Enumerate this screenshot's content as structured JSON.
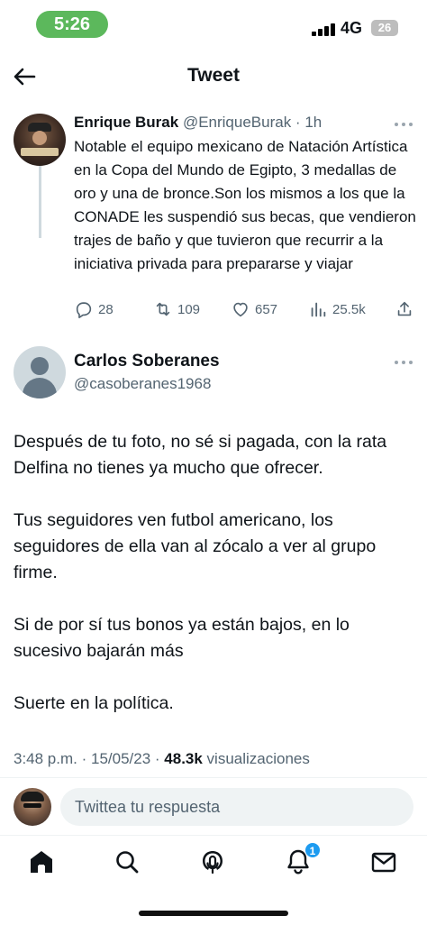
{
  "status_bar": {
    "time": "5:26",
    "network": "4G",
    "battery": "26"
  },
  "header": {
    "title": "Tweet"
  },
  "original_tweet": {
    "name": "Enrique Burak",
    "handle": "@EnriqueBurak",
    "separator": " · ",
    "time": "1h",
    "text": "Notable el equipo mexicano de Natación Artística en la Copa del Mundo de Egipto, 3 medallas de oro y una de bronce.Son los mismos a los que la CONADE les suspendió sus becas, que vendieron trajes de baño y que tuvieron que recurrir a la iniciativa privada para prepararse y viajar",
    "replies": "28",
    "retweets": "109",
    "likes": "657",
    "views": "25.5k"
  },
  "reply_tweet": {
    "name": "Carlos Soberanes",
    "handle": "@casoberanes1968",
    "paragraphs": [
      "Después de tu foto, no sé si pagada, con la rata Delfina no tienes ya mucho que ofrecer.",
      "Tus seguidores ven futbol americano, los seguidores de ella van al zócalo a ver al grupo firme.",
      "Si de por sí tus bonos ya están bajos, en lo sucesivo bajarán más",
      "Suerte en la política."
    ],
    "time": "3:48 p.m.",
    "dot": " · ",
    "date": "15/05/23",
    "views_count": "48.3k",
    "views_label": " visualizaciones"
  },
  "composer": {
    "placeholder": "Twittea tu respuesta"
  },
  "nav": {
    "notification_count": "1"
  },
  "colors": {
    "accent": "#1d9bf0",
    "text": "#0f1419",
    "muted": "#536471",
    "time_pill": "#5cb85c"
  }
}
